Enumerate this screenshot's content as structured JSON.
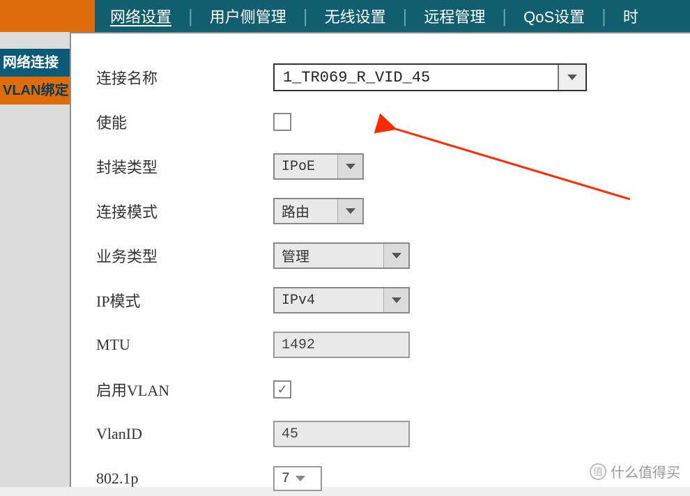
{
  "topnav": {
    "items": [
      {
        "label": "网络设置",
        "active": true
      },
      {
        "label": "用户侧管理"
      },
      {
        "label": "无线设置"
      },
      {
        "label": "远程管理"
      },
      {
        "label": "QoS设置"
      },
      {
        "label": "时"
      }
    ]
  },
  "sidebar": {
    "items": [
      {
        "label": "网络连接",
        "style": "side-active"
      },
      {
        "label": "VLAN绑定",
        "style": "side-orange"
      }
    ]
  },
  "form": {
    "conn_name_label": "连接名称",
    "conn_name_value": "1_TR069_R_VID_45",
    "enable_label": "使能",
    "enable_checked": false,
    "encap_label": "封装类型",
    "encap_value": "IPoE",
    "mode_label": "连接模式",
    "mode_value": "路由",
    "svc_label": "业务类型",
    "svc_value": "管理",
    "ipmode_label": "IP模式",
    "ipmode_value": "IPv4",
    "mtu_label": "MTU",
    "mtu_value": "1492",
    "vlan_en_label": "启用VLAN",
    "vlan_en_checked": true,
    "vlanid_label": "VlanID",
    "vlanid_value": "45",
    "dot1p_label": "802.1p",
    "dot1p_value": "7"
  },
  "watermark": {
    "text": "什么值得买"
  },
  "colors": {
    "topbar_bg": "#115e6e",
    "accent_orange": "#de6c0a",
    "arrow_red": "#ff2a00"
  }
}
